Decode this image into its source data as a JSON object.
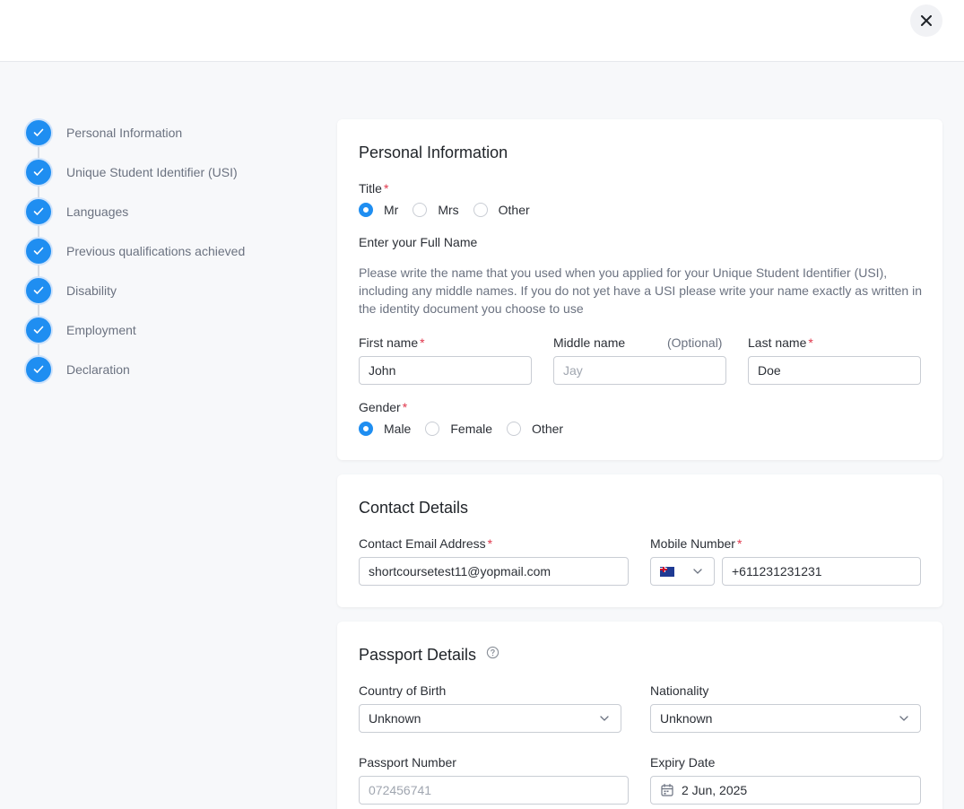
{
  "header": {
    "close_icon": "close-icon"
  },
  "steps": [
    {
      "label": "Personal Information",
      "status": "complete"
    },
    {
      "label": "Unique Student Identifier (USI)",
      "status": "complete"
    },
    {
      "label": "Languages",
      "status": "complete"
    },
    {
      "label": "Previous qualifications achieved",
      "status": "complete"
    },
    {
      "label": "Disability",
      "status": "complete"
    },
    {
      "label": "Employment",
      "status": "complete"
    },
    {
      "label": "Declaration",
      "status": "complete"
    }
  ],
  "personal": {
    "title": "Personal Information",
    "title_label": "Title",
    "title_options": [
      "Mr",
      "Mrs",
      "Other"
    ],
    "title_selected": "Mr",
    "full_name_heading": "Enter your Full Name",
    "help_text": "Please write the name that you used when you applied for your Unique Student Identifier (USI), including any middle names. If you do not yet have a USI please write your name exactly as written in the identity document you choose to use",
    "first_name_label": "First name",
    "first_name_value": "John",
    "middle_name_label": "Middle name",
    "middle_name_optional": "(Optional)",
    "middle_name_placeholder": "Jay",
    "last_name_label": "Last name",
    "last_name_value": "Doe",
    "gender_label": "Gender",
    "gender_options": [
      "Male",
      "Female",
      "Other"
    ],
    "gender_selected": "Male"
  },
  "contact": {
    "title": "Contact Details",
    "email_label": "Contact Email Address",
    "email_value": "shortcoursetest11@yopmail.com",
    "mobile_label": "Mobile Number",
    "country_flag": "australia-flag",
    "mobile_value": "+611231231231"
  },
  "passport": {
    "title": "Passport Details",
    "country_of_birth_label": "Country of Birth",
    "country_of_birth_value": "Unknown",
    "nationality_label": "Nationality",
    "nationality_value": "Unknown",
    "passport_number_label": "Passport Number",
    "passport_number_placeholder": "072456741",
    "expiry_label": "Expiry Date",
    "expiry_value": "2 Jun, 2025"
  },
  "colors": {
    "accent": "#1f8ef1",
    "required": "#e0364b",
    "background": "#f7f8fa"
  }
}
